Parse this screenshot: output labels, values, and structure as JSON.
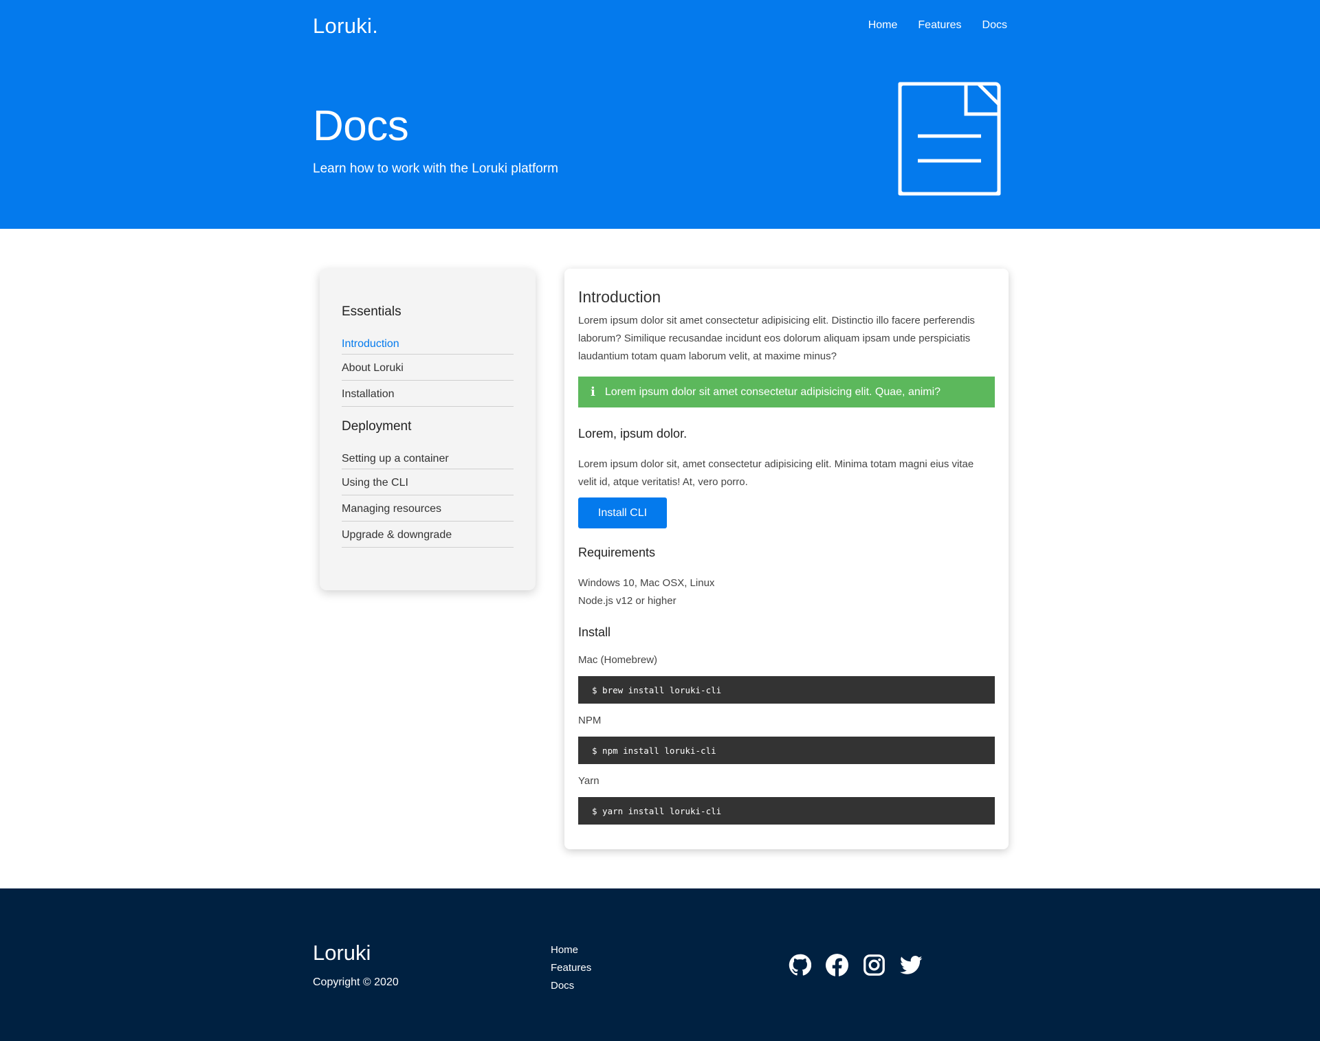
{
  "header": {
    "logo": "Loruki.",
    "nav": [
      "Home",
      "Features",
      "Docs"
    ]
  },
  "hero": {
    "title": "Docs",
    "subtitle": "Learn how to work with the Loruki platform",
    "icon": "document-icon"
  },
  "sidebar": {
    "sections": [
      {
        "title": "Essentials",
        "items": [
          "Introduction",
          "About Loruki",
          "Installation"
        ],
        "active": "Introduction"
      },
      {
        "title": "Deployment",
        "items": [
          "Setting up a container",
          "Using the CLI",
          "Managing resources",
          "Upgrade & downgrade"
        ]
      }
    ]
  },
  "content": {
    "title": "Introduction",
    "intro": "Lorem ipsum dolor sit amet consectetur adipisicing elit. Distinctio illo facere perferendis laborum? Similique recusandae incidunt eos dolorum aliquam ipsam unde perspiciatis laudantium totam quam laborum velit, at maxime minus?",
    "alert": "Lorem ipsum dolor sit amet consectetur adipisicing elit. Quae, animi?",
    "subheading": "Lorem, ipsum dolor.",
    "subtext": "Lorem ipsum dolor sit, amet consectetur adipisicing elit. Minima totam magni eius vitae velit id, atque veritatis! At, vero porro.",
    "button": "Install CLI",
    "requirements_title": "Requirements",
    "requirements": [
      "Windows 10, Mac OSX, Linux",
      "Node.js v12 or higher"
    ],
    "install_title": "Install",
    "installs": [
      {
        "label": "Mac (Homebrew)",
        "command": "$ brew install loruki-cli"
      },
      {
        "label": "NPM",
        "command": "$ npm install loruki-cli"
      },
      {
        "label": "Yarn",
        "command": "$ yarn install loruki-cli"
      }
    ]
  },
  "footer": {
    "brand": "Loruki",
    "copyright": "Copyright © 2020",
    "links": [
      "Home",
      "Features",
      "Docs"
    ],
    "social": [
      "github-icon",
      "facebook-icon",
      "instagram-icon",
      "twitter-icon"
    ]
  },
  "colors": {
    "primary": "#047aed",
    "success": "#5cb85c",
    "dark": "#002141",
    "code_bg": "#333333"
  }
}
